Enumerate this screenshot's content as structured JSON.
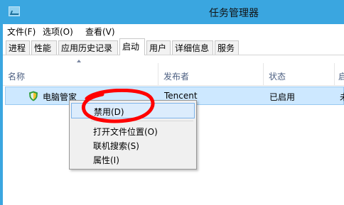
{
  "window": {
    "title": "任务管理器",
    "accent_color": "#3aa6e0",
    "app_icon": "task-manager-icon"
  },
  "menubar": {
    "items": [
      "文件(F)",
      "选项(O)",
      "查看(V)"
    ]
  },
  "tabs": {
    "items": [
      "进程",
      "性能",
      "应用历史记录",
      "启动",
      "用户",
      "详细信息",
      "服务"
    ],
    "active": "启动"
  },
  "table": {
    "columns": [
      "名称",
      "发布者",
      "状态",
      "启"
    ],
    "rows": [
      {
        "icon": "shield-icon",
        "name": "电脑管家",
        "publisher": "Tencent",
        "status": "已启用",
        "impact": "未"
      }
    ]
  },
  "context_menu": {
    "items": [
      "禁用(D)",
      "打开文件位置(O)",
      "联机搜索(S)",
      "属性(I)"
    ],
    "highlighted": "禁用(D)"
  },
  "annotation": {
    "color": "#ff0000"
  }
}
